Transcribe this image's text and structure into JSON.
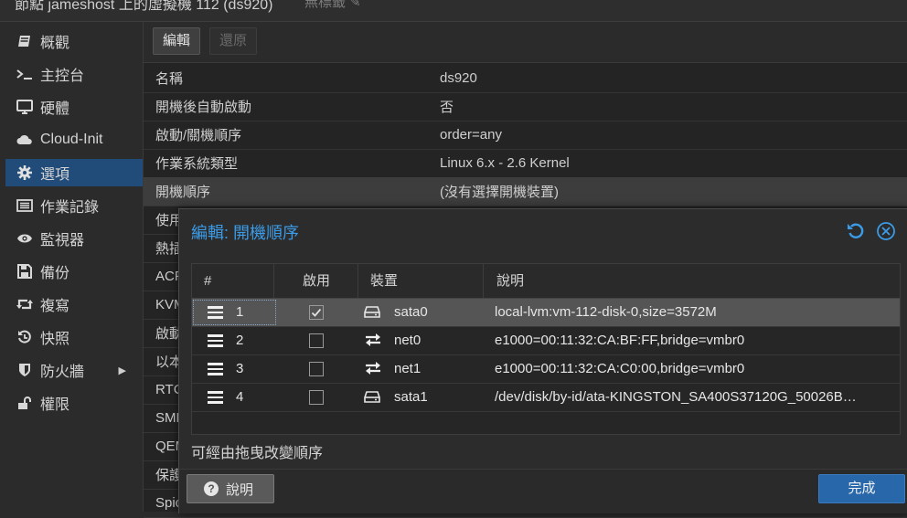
{
  "window": {
    "title": "節點 jameshost 上的虛擬機 112 (ds920)",
    "tags_label": "無標籤"
  },
  "sidebar": {
    "items": [
      {
        "label": "概觀",
        "icon": "book-icon"
      },
      {
        "label": "主控台",
        "icon": "terminal-icon"
      },
      {
        "label": "硬體",
        "icon": "monitor-icon"
      },
      {
        "label": "Cloud-Init",
        "icon": "cloud-icon"
      },
      {
        "label": "選項",
        "icon": "gear-icon",
        "active": true
      },
      {
        "label": "作業記錄",
        "icon": "list-icon"
      },
      {
        "label": "監視器",
        "icon": "eye-icon"
      },
      {
        "label": "備份",
        "icon": "floppy-icon"
      },
      {
        "label": "複寫",
        "icon": "retweet-icon"
      },
      {
        "label": "快照",
        "icon": "history-icon"
      },
      {
        "label": "防火牆",
        "icon": "shield-icon"
      },
      {
        "label": "權限",
        "icon": "unlock-icon"
      }
    ]
  },
  "toolbar": {
    "edit_label": "編輯",
    "revert_label": "還原"
  },
  "options": {
    "rows": [
      {
        "key": "名稱",
        "value": "ds920"
      },
      {
        "key": "開機後自動啟動",
        "value": "否"
      },
      {
        "key": "啟動/關機順序",
        "value": "order=any"
      },
      {
        "key": "作業系統類型",
        "value": "Linux 6.x - 2.6 Kernel"
      },
      {
        "key": "開機順序",
        "value": "(沒有選擇開機裝置)"
      },
      {
        "key": "使用",
        "value": ""
      },
      {
        "key": "熱插",
        "value": ""
      },
      {
        "key": "ACP",
        "value": ""
      },
      {
        "key": "KVM",
        "value": ""
      },
      {
        "key": "啟動",
        "value": ""
      },
      {
        "key": "以本",
        "value": ""
      },
      {
        "key": "RTC",
        "value": ""
      },
      {
        "key": "SMB",
        "value": ""
      },
      {
        "key": "QEM",
        "value": ""
      },
      {
        "key": "保護",
        "value": ""
      },
      {
        "key": "Spic",
        "value": ""
      }
    ]
  },
  "dialog": {
    "title": "編輯: 開機順序",
    "columns": {
      "num": "#",
      "enabled": "啟用",
      "device": "裝置",
      "desc": "說明"
    },
    "rows": [
      {
        "num": "1",
        "enabled": true,
        "device": "sata0",
        "device_icon": "hdd-icon",
        "desc": "local-lvm:vm-112-disk-0,size=3572M"
      },
      {
        "num": "2",
        "enabled": false,
        "device": "net0",
        "device_icon": "exchange-icon",
        "desc": "e1000=00:11:32:CA:BF:FF,bridge=vmbr0"
      },
      {
        "num": "3",
        "enabled": false,
        "device": "net1",
        "device_icon": "exchange-icon",
        "desc": "e1000=00:11:32:CA:C0:00,bridge=vmbr0"
      },
      {
        "num": "4",
        "enabled": false,
        "device": "sata1",
        "device_icon": "hdd-icon",
        "desc": "/dev/disk/by-id/ata-KINGSTON_SA400S37120G_50026B…"
      }
    ],
    "hint": "可經由拖曳改變順序",
    "help_label": "說明",
    "done_label": "完成"
  },
  "colors": {
    "accent": "#3c9be6",
    "selected_nav": "#214c7a",
    "primary_button": "#2867aa"
  }
}
